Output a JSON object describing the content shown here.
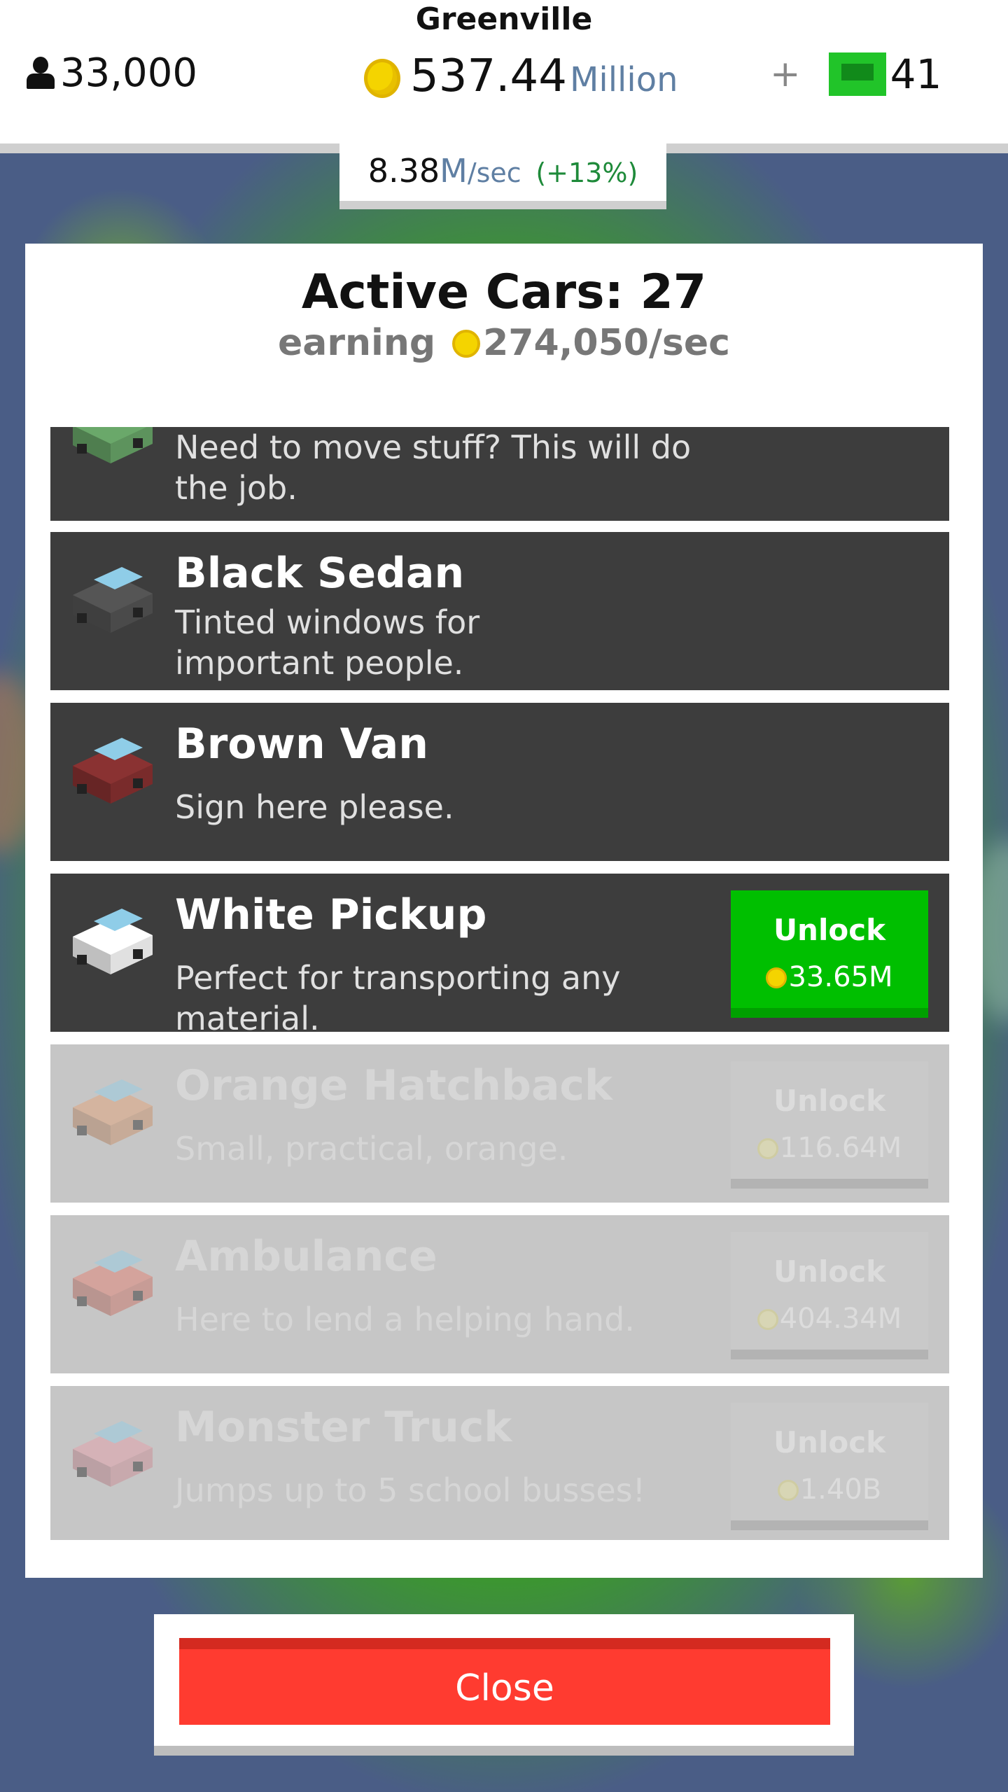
{
  "header": {
    "city": "Greenville",
    "population": "33,000",
    "money_value": "537.44",
    "money_unit": "Million",
    "plus": "+",
    "cash": "41",
    "rate_value": "8.38",
    "rate_unit": "M",
    "rate_suffix": "/sec",
    "rate_pct": "(+13%)"
  },
  "panel": {
    "title": "Active Cars: 27",
    "earning_label": "earning",
    "earning_value": "274,050/sec"
  },
  "cars": [
    {
      "name": "",
      "desc": "Need to move stuff? This will do the job.",
      "locked": false,
      "icon": "green-truck-icon",
      "color": "#6aa86a"
    },
    {
      "name": "Black Sedan",
      "desc": "Tinted windows for important people.",
      "locked": false,
      "icon": "black-sedan-icon",
      "color": "#555555"
    },
    {
      "name": "Brown Van",
      "desc": "Sign here please.",
      "locked": false,
      "icon": "brown-van-icon",
      "color": "#8a3232"
    },
    {
      "name": "White Pickup",
      "desc": "Perfect for transporting any material.",
      "locked": false,
      "icon": "white-pickup-icon",
      "color": "#ffffff",
      "unlock_label": "Unlock",
      "unlock_cost": "33.65M"
    },
    {
      "name": "Orange Hatchback",
      "desc": "Small, practical, orange.",
      "locked": true,
      "icon": "orange-hatchback-icon",
      "color": "#e6a070",
      "unlock_label": "Unlock",
      "unlock_cost": "116.64M"
    },
    {
      "name": "Ambulance",
      "desc": "Here to lend a helping hand.",
      "locked": true,
      "icon": "ambulance-icon",
      "color": "#e57a6b",
      "unlock_label": "Unlock",
      "unlock_cost": "404.34M"
    },
    {
      "name": "Monster Truck",
      "desc": "Jumps up to 5 school busses!",
      "locked": true,
      "icon": "monster-truck-icon",
      "color": "#e89aa6",
      "unlock_label": "Unlock",
      "unlock_cost": "1.40B"
    }
  ],
  "close_label": "Close",
  "colors": {
    "unlock_green": "#00bf00",
    "close_red": "#ff3b30",
    "row_dark": "#3d3d3d",
    "row_locked": "#c6c6c6",
    "coin_yellow": "#f4d400"
  }
}
